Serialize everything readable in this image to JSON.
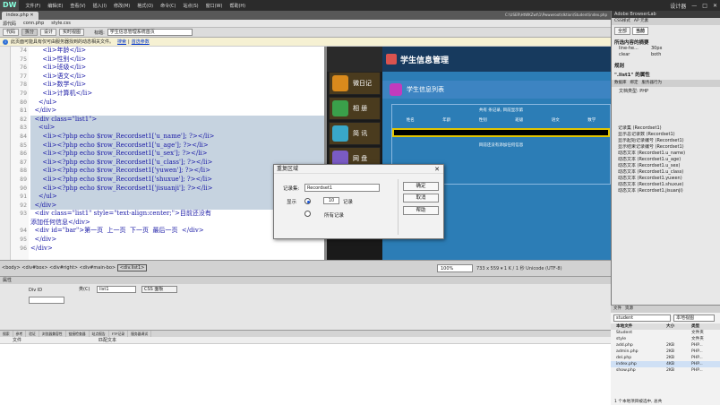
{
  "app": {
    "logo": "DW"
  },
  "menu": [
    "文件(F)",
    "编辑(E)",
    "查看(V)",
    "插入(I)",
    "修改(M)",
    "格式(O)",
    "命令(C)",
    "站点(S)",
    "窗口(W)",
    "帮助(H)"
  ],
  "window_controls": {
    "user": "设计器",
    "minimize": "—",
    "maximize": "□",
    "close": "✕"
  },
  "doc_tab": "index.php ✕",
  "doc_path": "C:\\USER\\HtWKZwt\\1\\Pwwwroot\\dktion\\Student\\index.php",
  "related_files": [
    "源代码",
    "conn.php",
    "style.css"
  ],
  "view_buttons": [
    "代码",
    "拆分",
    "设计",
    "实时视图"
  ],
  "title_label": "标题:",
  "title_value": "学生信息管理系统首页",
  "infobar": {
    "text": "此页面可能具有仅可由服务器找到的动态相关文件。",
    "link1": "搜索",
    "sep": "|",
    "link2": "首选参数"
  },
  "line_numbers": [
    "74",
    "75",
    "76",
    "77",
    "78",
    "79",
    "80",
    "81",
    "82",
    "83",
    "84",
    "85",
    "86",
    "87",
    "88",
    "89",
    "90",
    "91",
    "92",
    "93",
    "",
    "94",
    "95",
    "96"
  ],
  "code_lines": [
    "      <li>年龄</li>",
    "      <li>性别</li>",
    "      <li>班级</li>",
    "      <li>语文</li>",
    "      <li>数学</li>",
    "      <li>计算机</li>",
    "    </ul>",
    "  </div>",
    "  <div class=\"list1\">",
    "    <ul>",
    "      <li><?php echo $row_Recordset1['u_name']; ?></li>",
    "      <li><?php echo $row_Recordset1['u_age']; ?></li>",
    "      <li><?php echo $row_Recordset1['u_sex']; ?></li>",
    "      <li><?php echo $row_Recordset1['u_class']; ?></li>",
    "      <li><?php echo $row_Recordset1['yuwen']; ?></li>",
    "      <li><?php echo $row_Recordset1['shuxue']; ?></li>",
    "      <li><?php echo $row_Recordset1['jisuanji']; ?></li>",
    "    </ul>",
    "  </div>",
    "  <div class=\"list1\" style=\"text-align:center;\">目前还没有",
    "添加任何信息</div>",
    "  <div id=\"bar\">第一页  上一页  下一页  最后一页  </div>",
    "  </div>",
    "</div>"
  ],
  "design": {
    "site_title": "学生信息管理",
    "nav": [
      "微日记",
      "相 册",
      "简 讯",
      "网 盘"
    ],
    "list_title": "学生信息列表",
    "record_line": "共有 条记录, 目前显示第",
    "columns": [
      "姓名",
      "年龄",
      "性别",
      "班级",
      "语文",
      "数学"
    ],
    "empty_msg": "目前还没有添加任何信息"
  },
  "dialog": {
    "title": "重复区域",
    "close": "✕",
    "recordset_label": "记录集:",
    "recordset_value": "Recordset1",
    "show_label": "显示",
    "count_value": "10",
    "records_label": "记录",
    "all_label": "所有记录",
    "ok": "确定",
    "cancel": "取消",
    "help": "帮助"
  },
  "status": {
    "crumb": "<body> <div#box> <div#right> <div#main-bo> ",
    "crumb_last": "<div.list1>",
    "zoom": "100%",
    "dims": "733 x 559 ▾ 1 K / 1 秒 Unicode (UTF-8)"
  },
  "properties": {
    "title": "属性",
    "div_id": "Div ID",
    "class_label": "类(C)",
    "class_value": "list1",
    "css_btn": "CSS 面板"
  },
  "results": {
    "tabs": [
      "搜索",
      "参考",
      "验证",
      "浏览器兼容性",
      "链接检查器",
      "站点报告",
      "FTP记录",
      "服务器调试"
    ],
    "col1": "文件",
    "col2": "匹配文本"
  },
  "right": {
    "browserlab": "Adobe BrowserLab",
    "css_tabs": [
      "CSS样式",
      "AP 元素"
    ],
    "sub_tabs": [
      "全部",
      "当前"
    ],
    "section1": "所选内容的摘要",
    "props": [
      {
        "k": "line-he...",
        "v": "30px"
      },
      {
        "k": "clear",
        "v": "both"
      }
    ],
    "section2": "规则",
    "rule": "\".list1\" 的属性",
    "db_tabs": [
      "数据库",
      "绑定",
      "服务器行为"
    ],
    "doc_type": "文档类型: PHP",
    "bindings": [
      "记录集 (Recordset1)",
      "显示总记录数 (Recordset1)",
      "显示起始记录编号 (Recordset1)",
      "显示结束记录编号 (Recordset1)",
      "动态文本 (Recordset1.u_name)",
      "动态文本 (Recordset1.u_age)",
      "动态文本 (Recordset1.u_sex)",
      "动态文本 (Recordset1.u_class)",
      "动态文本 (Recordset1.yuwen)",
      "动态文本 (Recordset1.shuxue)",
      "动态文本 (Recordset1.jisuanji)"
    ],
    "files_tabs": [
      "文件",
      "资源"
    ],
    "site_select": "student",
    "view_select": "本地视图",
    "file_head": [
      "本地文件",
      "大小",
      "类型"
    ],
    "files": [
      {
        "n": "Student",
        "s": "",
        "t": "文件夹"
      },
      {
        "n": "style",
        "s": "",
        "t": "文件夹"
      },
      {
        "n": "add.php",
        "s": "2KB",
        "t": "PHP..."
      },
      {
        "n": "admin.php",
        "s": "2KB",
        "t": "PHP..."
      },
      {
        "n": "del.php",
        "s": "2KB",
        "t": "PHP..."
      },
      {
        "n": "index.php",
        "s": "4KB",
        "t": "PHP..."
      },
      {
        "n": "show.php",
        "s": "2KB",
        "t": "PHP..."
      }
    ],
    "file_status": "1 个本地项目被选中, 总共"
  },
  "colors": {
    "accent": "#1a56d6",
    "selection": "#c6d3e0"
  }
}
